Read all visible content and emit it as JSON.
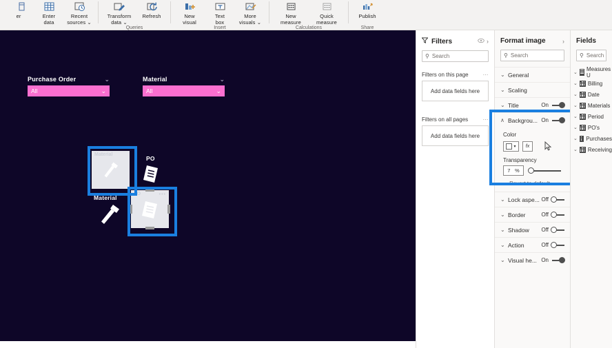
{
  "ribbon": {
    "groups": [
      {
        "name": "",
        "buttons": [
          {
            "label_line1": "",
            "label_line2": "er",
            "icon": "enter-data-partial-icon"
          },
          {
            "label_line1": "Enter",
            "label_line2": "data",
            "icon": "enter-data-icon"
          },
          {
            "label_line1": "Recent",
            "label_line2": "sources ⌄",
            "icon": "recent-sources-icon"
          }
        ]
      },
      {
        "name": "Queries",
        "buttons": [
          {
            "label_line1": "Transform",
            "label_line2": "data ⌄",
            "icon": "transform-data-icon"
          },
          {
            "label_line1": "Refresh",
            "label_line2": "",
            "icon": "refresh-icon"
          }
        ]
      },
      {
        "name": "Insert",
        "buttons": [
          {
            "label_line1": "New",
            "label_line2": "visual",
            "icon": "new-visual-icon"
          },
          {
            "label_line1": "Text",
            "label_line2": "box",
            "icon": "text-box-icon"
          },
          {
            "label_line1": "More",
            "label_line2": "visuals ⌄",
            "icon": "more-visuals-icon"
          }
        ]
      },
      {
        "name": "Calculations",
        "buttons": [
          {
            "label_line1": "New",
            "label_line2": "measure",
            "icon": "new-measure-icon"
          },
          {
            "label_line1": "Quick",
            "label_line2": "measure",
            "icon": "quick-measure-icon"
          }
        ]
      },
      {
        "name": "Share",
        "buttons": [
          {
            "label_line1": "Publish",
            "label_line2": "",
            "icon": "publish-icon"
          }
        ]
      }
    ]
  },
  "canvas": {
    "background_color": "#0e0628",
    "slicer_color": "#fb6fd0",
    "slicers": [
      {
        "title": "Purchase Order",
        "value": "All",
        "chevron": "⌄"
      },
      {
        "title": "Material",
        "value": "All",
        "chevron": "⌄"
      }
    ],
    "image_visuals": [
      {
        "title": "Material",
        "icon": "hammer-icon",
        "selected": true
      },
      {
        "title": "PO",
        "icon": "purchase-order-document-icon",
        "selected": true
      }
    ],
    "free_icons": [
      {
        "label": "PO",
        "icon": "purchase-order-document-icon"
      },
      {
        "label": "Material",
        "icon": "hammer-icon"
      }
    ],
    "selection_color": "#1a7fe0"
  },
  "filters_pane": {
    "title": "Filters",
    "eye_icon": "eye-icon",
    "expand_icon": "chevron-right-icon",
    "search_placeholder": "Search",
    "search_icon": "search-icon",
    "sections": [
      {
        "label": "Filters on this page",
        "menu": "⋯",
        "dropzone": "Add data fields here"
      },
      {
        "label": "Filters on all pages",
        "menu": "⋯",
        "dropzone": "Add data fields here"
      }
    ]
  },
  "format_pane": {
    "title": "Format image",
    "expand_icon": "chevron-right-icon",
    "search_placeholder": "Search",
    "search_icon": "search-icon",
    "rows_top": [
      {
        "name": "General",
        "chevron": "⌄",
        "toggle": null
      },
      {
        "name": "Scaling",
        "chevron": "⌄",
        "toggle": null
      },
      {
        "name": "Title",
        "chevron": "⌄",
        "toggle": "On"
      }
    ],
    "background": {
      "name": "Backgrou...",
      "chevron": "∧",
      "toggle": "On",
      "color_label": "Color",
      "color_value": "#ffffff",
      "color_chevron": "▾",
      "fx_label": "fx",
      "transparency_label": "Transparency",
      "transparency_value": "7",
      "transparency_unit": "%"
    },
    "revert_label": "Revert to default",
    "rows_bottom": [
      {
        "name": "Lock aspe...",
        "chevron": "⌄",
        "toggle": "Off"
      },
      {
        "name": "Border",
        "chevron": "⌄",
        "toggle": "Off"
      },
      {
        "name": "Shadow",
        "chevron": "⌄",
        "toggle": "Off"
      },
      {
        "name": "Action",
        "chevron": "⌄",
        "toggle": "Off"
      },
      {
        "name": "Visual he...",
        "chevron": "⌄",
        "toggle": "On"
      }
    ],
    "highlight_color": "#1a7fe0"
  },
  "fields_pane": {
    "title": "Fields",
    "search_placeholder": "Search",
    "search_icon": "search-icon",
    "tables": [
      {
        "name": "Measures U",
        "icon": "measure-table-icon",
        "chevron": "⌄"
      },
      {
        "name": "Billing",
        "icon": "table-icon",
        "chevron": "⌄"
      },
      {
        "name": "Date",
        "icon": "table-icon",
        "chevron": "⌄"
      },
      {
        "name": "Materials",
        "icon": "table-icon",
        "chevron": "⌄"
      },
      {
        "name": "Period",
        "icon": "table-icon",
        "chevron": "⌄"
      },
      {
        "name": "PO's",
        "icon": "table-icon",
        "chevron": "⌄"
      },
      {
        "name": "Purchases",
        "icon": "table-icon",
        "chevron": "⌄"
      },
      {
        "name": "Receiving",
        "icon": "table-icon",
        "chevron": "⌄"
      }
    ]
  }
}
